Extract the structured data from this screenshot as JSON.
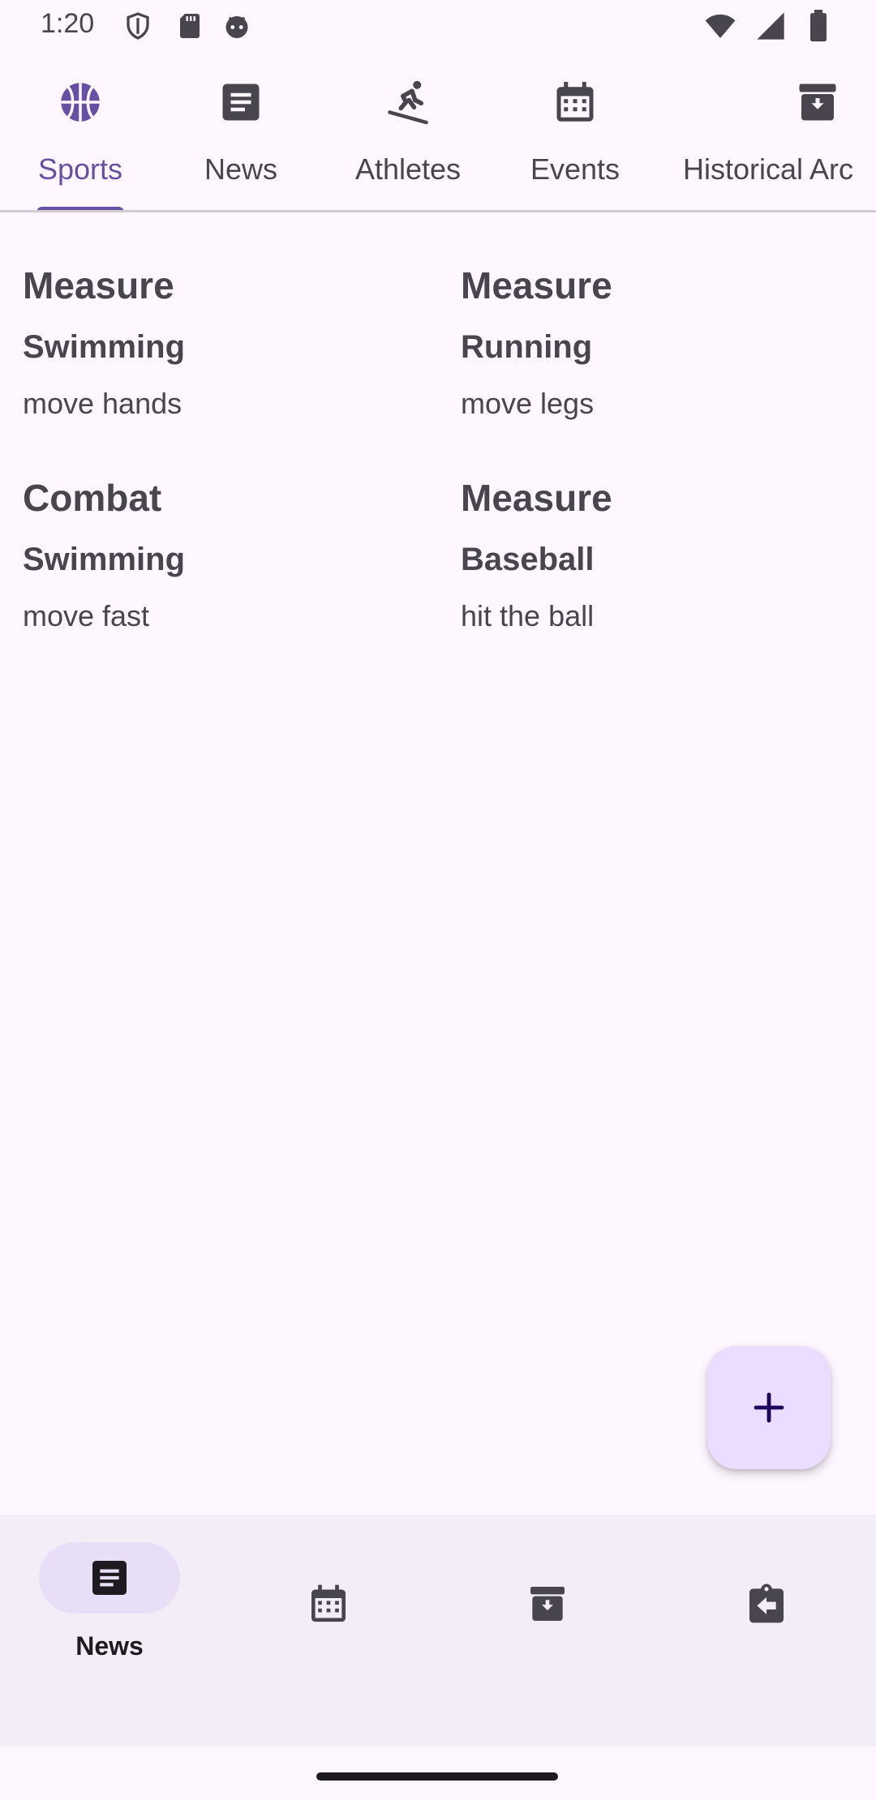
{
  "status_bar": {
    "time": "1:20",
    "left_icons": [
      "shield-icon",
      "sd-card-icon",
      "android-face-icon"
    ],
    "right_icons": [
      "wifi-icon",
      "cell-signal-icon",
      "battery-icon"
    ]
  },
  "top_tabs": [
    {
      "label": "Sports",
      "icon": "basketball-icon",
      "selected": true
    },
    {
      "label": "News",
      "icon": "article-icon",
      "selected": false
    },
    {
      "label": "Athletes",
      "icon": "skier-icon",
      "selected": false
    },
    {
      "label": "Events",
      "icon": "calendar-icon",
      "selected": false
    },
    {
      "label": "Historical Arc",
      "icon": "archive-icon",
      "selected": false
    }
  ],
  "cards": [
    {
      "title": "Measure",
      "subtitle": "Swimming",
      "description": "move hands"
    },
    {
      "title": "Measure",
      "subtitle": "Running",
      "description": "move legs"
    },
    {
      "title": "Combat",
      "subtitle": "Swimming",
      "description": "move fast"
    },
    {
      "title": "Measure",
      "subtitle": "Baseball",
      "description": "hit the ball"
    }
  ],
  "fab": {
    "icon": "plus-icon"
  },
  "bottom_nav": [
    {
      "label": "News",
      "icon": "article-icon",
      "selected": true
    },
    {
      "label": "",
      "icon": "calendar-icon",
      "selected": false
    },
    {
      "label": "",
      "icon": "archive-icon",
      "selected": false
    },
    {
      "label": "",
      "icon": "assignment-return-icon",
      "selected": false
    }
  ],
  "colors": {
    "background": "#FEF7FF",
    "primary": "#6750A4",
    "on_surface_variant": "#49454F",
    "nav_background": "#F3EDF7",
    "nav_indicator": "#E8DEF8",
    "fab_container": "#EADDFF",
    "fab_icon": "#21005D"
  }
}
